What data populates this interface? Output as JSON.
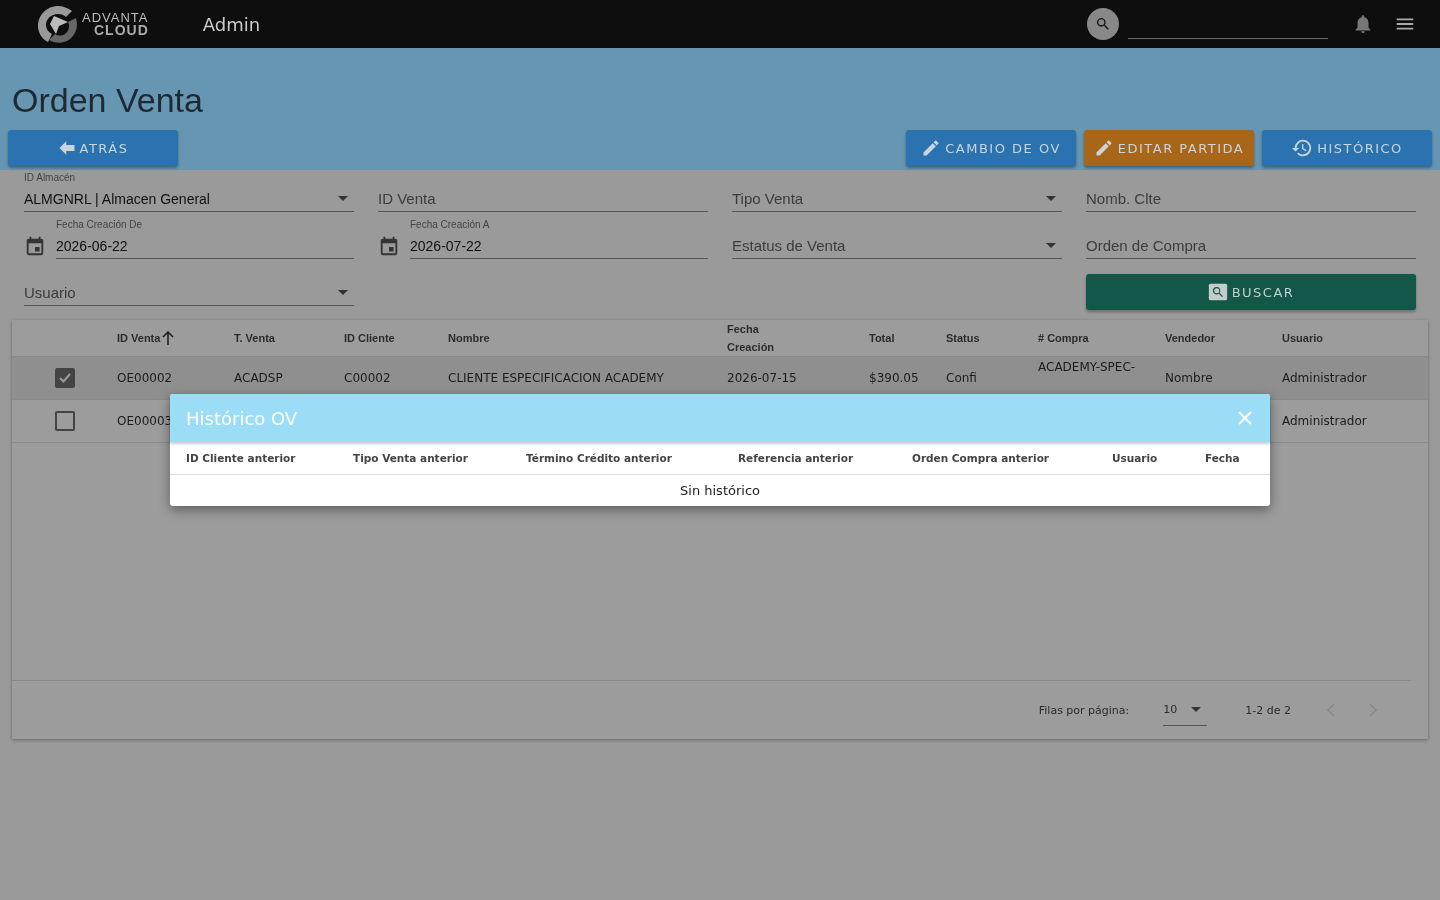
{
  "app_bar": {
    "logo_line1": "ADVANTA",
    "logo_line2": "CLOUD",
    "title": "Admin"
  },
  "page": {
    "title": "Orden Venta"
  },
  "actions": [
    {
      "label": "ATRÁS",
      "kind": "back"
    },
    {
      "label": "CAMBIO DE OV",
      "kind": "change"
    },
    {
      "label": "EDITAR PARTIDA",
      "kind": "edit_item"
    },
    {
      "label": "HISTÓRICO",
      "kind": "history"
    }
  ],
  "filters": [
    {
      "kind": "select",
      "label": "ID Almacén",
      "value": "ALMGNRL | Almacen General"
    },
    {
      "kind": "text",
      "label": "ID Venta"
    },
    {
      "kind": "select",
      "label": "Tipo Venta"
    },
    {
      "kind": "text",
      "label": "Nomb. Clte"
    },
    {
      "kind": "date",
      "label": "Fecha Creación De",
      "value": "2026-06-22"
    },
    {
      "kind": "date",
      "label": "Fecha Creación A",
      "value": "2026-07-22"
    },
    {
      "kind": "select",
      "label": "Estatus de Venta"
    },
    {
      "kind": "text",
      "label": "Orden de Compra"
    },
    {
      "kind": "select",
      "label": "Usuario"
    }
  ],
  "search_button": {
    "label": "BUSCAR"
  },
  "table": {
    "columns": [
      {
        "label": "ID Venta",
        "sorted": true
      },
      {
        "label": "T. Venta",
        "sorted": false
      },
      {
        "label": "ID Cliente",
        "sorted": false
      },
      {
        "label": "Nombre",
        "sorted": false
      },
      {
        "label": "Fecha Creación",
        "sorted": false
      },
      {
        "label": "Total",
        "sorted": false
      },
      {
        "label": "Status",
        "sorted": false
      },
      {
        "label": "# Compra",
        "sorted": false
      },
      {
        "label": "Vendedor",
        "sorted": false
      },
      {
        "label": "Usuario",
        "sorted": false
      }
    ],
    "rows": [
      {
        "selected": true,
        "id_venta": "OE00002",
        "t_venta": "ACADSP",
        "id_cliente": "C00002",
        "nombre": "CLIENTE ESPECIFICACION ACADEMY",
        "fecha_creacion": "2026-07-15",
        "total": "$390.05",
        "status": "Confi",
        "compra": "ACADEMY-SPEC-",
        "vendedor": "Nombre",
        "usuario": "Administrador"
      },
      {
        "selected": false,
        "id_venta": "OE00003",
        "usuario": "Administrador"
      }
    ]
  },
  "pagination": {
    "rows_per_page_label": "Filas por página:",
    "rows_per_page": "10",
    "range": "1-2 de 2"
  },
  "dialog": {
    "title": "Histórico OV",
    "columns": [
      "ID Cliente anterior",
      "Tipo Venta anterior",
      "Término Crédito anterior",
      "Referencia anterior",
      "Orden Compra anterior",
      "Usuario",
      "Fecha"
    ],
    "empty_text": "Sin histórico"
  }
}
